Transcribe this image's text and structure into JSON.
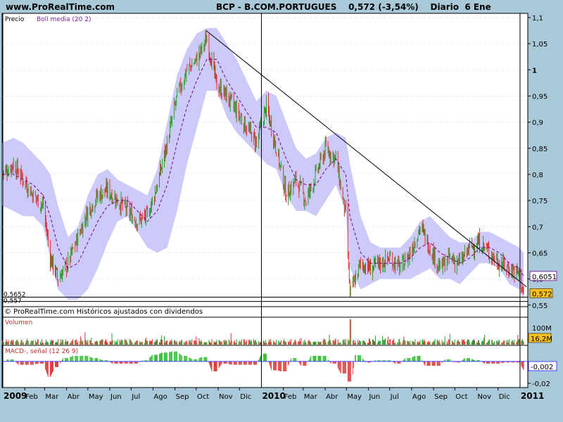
{
  "header": {
    "site": "www.ProRealTime.com",
    "instrument": "BCP - B.COM.PORTUGUES",
    "price_change": "0,572 (-3,54%)",
    "period_info": "Diario  6 Ene"
  },
  "colors": {
    "background": "#a9c9d9",
    "panel": "#ffffff",
    "bollinger_band": "#cccaf8",
    "up_bar": "#2aa02a",
    "down_bar": "#e03030",
    "bollinger_mid": "#7a0080",
    "trendline": "#000000",
    "last_price_box": "#f8c020",
    "macd_bar_pos": "#40c040",
    "macd_bar_neg": "#e04040",
    "signal_line": "#4040ff"
  },
  "chart_data": [
    {
      "type": "line",
      "panel": "price",
      "title": "BCP - B.COM.PORTUGUES",
      "legend": [
        "Precio",
        "Boll media (20 2)"
      ],
      "ylabel": "",
      "yticks": [
        {
          "value": 1.1,
          "label": "1,1"
        },
        {
          "value": 1.05,
          "label": "1,05"
        },
        {
          "value": 1.0,
          "label": "1"
        },
        {
          "value": 0.95,
          "label": "0,95"
        },
        {
          "value": 0.9,
          "label": "0,9"
        },
        {
          "value": 0.85,
          "label": "0,85"
        },
        {
          "value": 0.8,
          "label": "0,8"
        },
        {
          "value": 0.75,
          "label": "0,75"
        },
        {
          "value": 0.7,
          "label": "0,7"
        },
        {
          "value": 0.65,
          "label": "0,65"
        },
        {
          "value": 0.6,
          "label": "0,6"
        },
        {
          "value": 0.55,
          "label": "0,55"
        }
      ],
      "ylim": [
        0.547,
        1.108
      ],
      "x": [
        "2008-12-31",
        "2009-01-16",
        "2009-01-30",
        "2009-02-13",
        "2009-02-27",
        "2009-03-09",
        "2009-03-20",
        "2009-04-03",
        "2009-04-17",
        "2009-05-01",
        "2009-05-15",
        "2009-05-29",
        "2009-06-12",
        "2009-06-26",
        "2009-07-10",
        "2009-07-24",
        "2009-08-07",
        "2009-08-21",
        "2009-09-04",
        "2009-09-18",
        "2009-10-02",
        "2009-10-16",
        "2009-10-30",
        "2009-11-13",
        "2009-11-27",
        "2009-12-11",
        "2009-12-25",
        "2010-01-08",
        "2010-01-22",
        "2010-02-05",
        "2010-02-19",
        "2010-03-05",
        "2010-03-19",
        "2010-04-02",
        "2010-04-16",
        "2010-04-30",
        "2010-05-06",
        "2010-05-21",
        "2010-06-04",
        "2010-06-18",
        "2010-07-02",
        "2010-07-16",
        "2010-07-30",
        "2010-08-13",
        "2010-08-27",
        "2010-09-10",
        "2010-09-24",
        "2010-10-08",
        "2010-10-22",
        "2010-11-05",
        "2010-11-19",
        "2010-12-03",
        "2010-12-17",
        "2010-12-31",
        "2011-01-06"
      ],
      "series": [
        {
          "name": "Precio",
          "values": [
            0.8,
            0.82,
            0.79,
            0.76,
            0.74,
            0.64,
            0.6,
            0.63,
            0.68,
            0.73,
            0.76,
            0.77,
            0.75,
            0.73,
            0.71,
            0.72,
            0.78,
            0.86,
            0.95,
            1.0,
            1.02,
            1.06,
            0.97,
            0.95,
            0.92,
            0.89,
            0.86,
            0.93,
            0.85,
            0.76,
            0.79,
            0.75,
            0.8,
            0.85,
            0.83,
            0.72,
            0.57,
            0.63,
            0.62,
            0.63,
            0.64,
            0.62,
            0.65,
            0.7,
            0.66,
            0.62,
            0.64,
            0.63,
            0.66,
            0.67,
            0.65,
            0.63,
            0.62,
            0.61,
            0.572
          ]
        },
        {
          "name": "Boll media (20 2)",
          "values": [
            0.8,
            0.8,
            0.79,
            0.78,
            0.76,
            0.72,
            0.66,
            0.62,
            0.63,
            0.67,
            0.71,
            0.74,
            0.75,
            0.75,
            0.73,
            0.71,
            0.73,
            0.78,
            0.86,
            0.93,
            0.98,
            1.02,
            1.02,
            0.98,
            0.95,
            0.92,
            0.89,
            0.89,
            0.88,
            0.83,
            0.79,
            0.78,
            0.78,
            0.81,
            0.83,
            0.8,
            0.72,
            0.65,
            0.63,
            0.63,
            0.63,
            0.63,
            0.64,
            0.66,
            0.67,
            0.65,
            0.64,
            0.63,
            0.64,
            0.66,
            0.66,
            0.65,
            0.63,
            0.62,
            0.605
          ]
        }
      ],
      "bollinger_upper": [
        0.86,
        0.87,
        0.86,
        0.84,
        0.82,
        0.8,
        0.74,
        0.68,
        0.7,
        0.76,
        0.8,
        0.81,
        0.79,
        0.78,
        0.77,
        0.76,
        0.81,
        0.9,
        0.99,
        1.04,
        1.07,
        1.08,
        1.08,
        1.05,
        1.02,
        0.98,
        0.94,
        0.96,
        0.95,
        0.9,
        0.85,
        0.83,
        0.84,
        0.87,
        0.88,
        0.87,
        0.82,
        0.72,
        0.67,
        0.66,
        0.66,
        0.66,
        0.68,
        0.71,
        0.72,
        0.7,
        0.68,
        0.67,
        0.67,
        0.69,
        0.69,
        0.68,
        0.67,
        0.66,
        0.65
      ],
      "bollinger_lower": [
        0.74,
        0.73,
        0.72,
        0.72,
        0.7,
        0.64,
        0.58,
        0.56,
        0.56,
        0.58,
        0.62,
        0.67,
        0.71,
        0.72,
        0.69,
        0.66,
        0.65,
        0.66,
        0.73,
        0.82,
        0.89,
        0.96,
        0.96,
        0.91,
        0.88,
        0.86,
        0.84,
        0.82,
        0.81,
        0.76,
        0.73,
        0.73,
        0.72,
        0.75,
        0.78,
        0.73,
        0.62,
        0.58,
        0.59,
        0.6,
        0.6,
        0.6,
        0.6,
        0.61,
        0.62,
        0.6,
        0.6,
        0.59,
        0.61,
        0.63,
        0.63,
        0.62,
        0.59,
        0.58,
        0.56
      ],
      "trendline": {
        "from": {
          "date": "2009-10-15",
          "value": 1.075
        },
        "to": {
          "date": "2011-01-10",
          "value": 0.585
        }
      },
      "levels": [
        {
          "value": 0.5652,
          "label": "0,5652"
        },
        {
          "value": 0.557,
          "label": "0,557"
        }
      ],
      "last_values": [
        {
          "value": 0.6051,
          "label": "0,6051"
        },
        {
          "value": 0.572,
          "label": "0,572"
        }
      ],
      "footer": "© ProRealTime.com  Históricos ajustados con dividendos"
    },
    {
      "type": "bar",
      "panel": "volume",
      "title": "Volumen",
      "yticks": [
        {
          "label": "100M"
        }
      ],
      "last_value": "16,2M"
    },
    {
      "type": "bar",
      "panel": "macd",
      "title": "MACD-, señal (12 26 9)",
      "yticks": [
        {
          "value": -0.02,
          "label": "-0,02"
        }
      ],
      "ylim": [
        -0.026,
        0.016
      ],
      "last_value": {
        "value": -0.002,
        "label": "-0,002"
      }
    }
  ],
  "x_axis": {
    "labels": [
      {
        "date": "2009-01-01",
        "label": "2009",
        "year": true
      },
      {
        "date": "2009-02-01",
        "label": "Feb"
      },
      {
        "date": "2009-03-01",
        "label": "Mar"
      },
      {
        "date": "2009-04-01",
        "label": "Abr"
      },
      {
        "date": "2009-05-01",
        "label": "May"
      },
      {
        "date": "2009-06-01",
        "label": "Jun"
      },
      {
        "date": "2009-07-01",
        "label": "Jul"
      },
      {
        "date": "2009-08-01",
        "label": "Ago"
      },
      {
        "date": "2009-09-01",
        "label": "Sep"
      },
      {
        "date": "2009-10-01",
        "label": "Oct"
      },
      {
        "date": "2009-11-01",
        "label": "Nov"
      },
      {
        "date": "2009-12-01",
        "label": "Dic"
      },
      {
        "date": "2010-01-01",
        "label": "2010",
        "year": true
      },
      {
        "date": "2010-02-01",
        "label": "Feb"
      },
      {
        "date": "2010-03-01",
        "label": "Mar"
      },
      {
        "date": "2010-04-01",
        "label": "Abr"
      },
      {
        "date": "2010-05-01",
        "label": "May"
      },
      {
        "date": "2010-06-01",
        "label": "Jun"
      },
      {
        "date": "2010-07-01",
        "label": "Jul"
      },
      {
        "date": "2010-08-01",
        "label": "Ago"
      },
      {
        "date": "2010-09-01",
        "label": "Sep"
      },
      {
        "date": "2010-10-01",
        "label": "Oct"
      },
      {
        "date": "2010-11-01",
        "label": "Nov"
      },
      {
        "date": "2010-12-01",
        "label": "Dic"
      },
      {
        "date": "2011-01-01",
        "label": "2011",
        "year": true
      }
    ]
  }
}
